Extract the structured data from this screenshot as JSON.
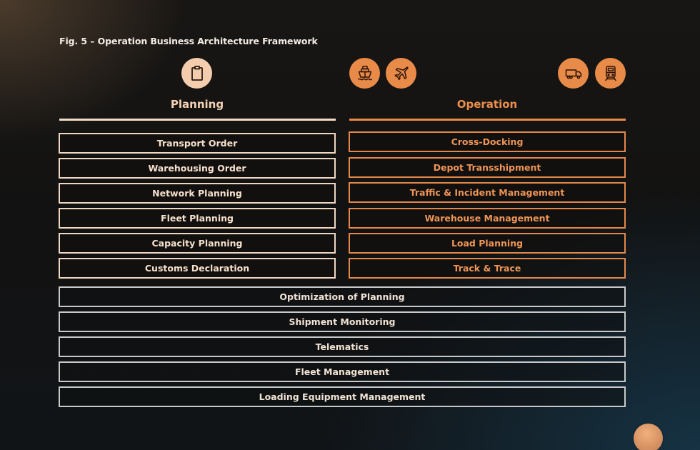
{
  "figure": {
    "title": "Fig. 5 – Operation Business Architecture Framework"
  },
  "colors": {
    "planning_accent": "#f4cdae",
    "operation_accent": "#e88a48",
    "shared_border": "#c9c9c9",
    "background": "#121212"
  },
  "icons": {
    "planning": "clipboard-icon",
    "operation": [
      "ship-icon",
      "airplane-icon",
      "truck-icon",
      "train-icon"
    ]
  },
  "planning": {
    "heading": "Planning",
    "items": [
      "Transport Order",
      "Warehousing Order",
      "Network Planning",
      "Fleet Planning",
      "Capacity Planning",
      "Customs Declaration"
    ]
  },
  "operation": {
    "heading": "Operation",
    "items": [
      "Cross-Docking",
      "Depot Transshipment",
      "Traffic & Incident Management",
      "Warehouse Management",
      "Load Planning",
      "Track & Trace"
    ]
  },
  "shared": {
    "items": [
      "Optimization of Planning",
      "Shipment Monitoring",
      "Telematics",
      "Fleet Management",
      "Loading Equipment Management"
    ]
  }
}
